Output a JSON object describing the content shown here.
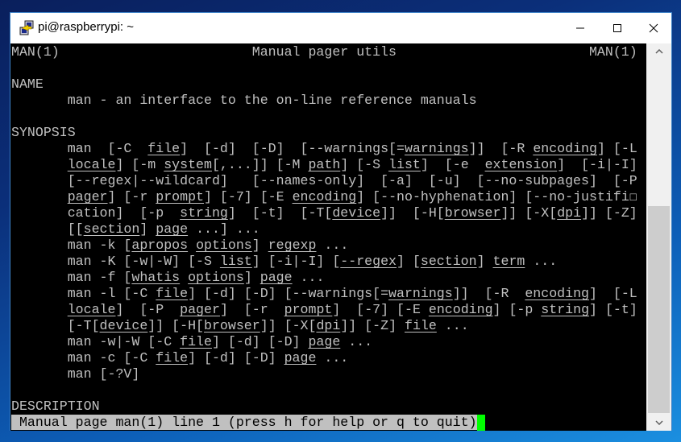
{
  "window": {
    "title": "pi@raspberrypi: ~",
    "icon": "putty-icon",
    "controls": {
      "minimize": "—",
      "maximize": "☐",
      "close": "✕"
    }
  },
  "terminal": {
    "lines": [
      [
        {
          "t": "MAN(1)                        Manual pager utils                        MAN(1)"
        }
      ],
      [
        {
          "t": ""
        }
      ],
      [
        {
          "t": "NAME"
        }
      ],
      [
        {
          "t": "       man - an interface to the on-line reference manuals"
        }
      ],
      [
        {
          "t": ""
        }
      ],
      [
        {
          "t": "SYNOPSIS"
        }
      ],
      [
        {
          "t": "       man  [-C  "
        },
        {
          "t": "file",
          "u": true
        },
        {
          "t": "]  [-d]  [-D]  [--warnings[="
        },
        {
          "t": "warnings",
          "u": true
        },
        {
          "t": "]]  [-R "
        },
        {
          "t": "encoding",
          "u": true
        },
        {
          "t": "] [-L"
        }
      ],
      [
        {
          "t": "       "
        },
        {
          "t": "locale",
          "u": true
        },
        {
          "t": "] [-m "
        },
        {
          "t": "system",
          "u": true
        },
        {
          "t": "[,...]] [-M "
        },
        {
          "t": "path",
          "u": true
        },
        {
          "t": "] [-S "
        },
        {
          "t": "list",
          "u": true
        },
        {
          "t": "]  [-e  "
        },
        {
          "t": "extension",
          "u": true
        },
        {
          "t": "]  [-i|-I]"
        }
      ],
      [
        {
          "t": "       [--regex|--wildcard]   [--names-only]  [-a]  [-u]  [--no-subpages]  [-P"
        }
      ],
      [
        {
          "t": "       "
        },
        {
          "t": "pager",
          "u": true
        },
        {
          "t": "] [-r "
        },
        {
          "t": "prompt",
          "u": true
        },
        {
          "t": "] [-7] [-E "
        },
        {
          "t": "encoding",
          "u": true
        },
        {
          "t": "] [--no-hyphenation] [--no-justifi☐"
        }
      ],
      [
        {
          "t": "       cation]  [-p  "
        },
        {
          "t": "string",
          "u": true
        },
        {
          "t": "]  [-t]  [-T["
        },
        {
          "t": "device",
          "u": true
        },
        {
          "t": "]]  [-H["
        },
        {
          "t": "browser",
          "u": true
        },
        {
          "t": "]] [-X["
        },
        {
          "t": "dpi",
          "u": true
        },
        {
          "t": "]] [-Z]"
        }
      ],
      [
        {
          "t": "       [["
        },
        {
          "t": "section",
          "u": true
        },
        {
          "t": "] "
        },
        {
          "t": "page",
          "u": true
        },
        {
          "t": " ...] ..."
        }
      ],
      [
        {
          "t": "       man -k ["
        },
        {
          "t": "apropos",
          "u": true
        },
        {
          "t": " "
        },
        {
          "t": "options",
          "u": true
        },
        {
          "t": "] "
        },
        {
          "t": "regexp",
          "u": true
        },
        {
          "t": " ..."
        }
      ],
      [
        {
          "t": "       man -K [-w|-W] [-S "
        },
        {
          "t": "list",
          "u": true
        },
        {
          "t": "] [-i|-I] ["
        },
        {
          "t": "--regex",
          "u": true
        },
        {
          "t": "] ["
        },
        {
          "t": "section",
          "u": true
        },
        {
          "t": "] "
        },
        {
          "t": "term",
          "u": true
        },
        {
          "t": " ..."
        }
      ],
      [
        {
          "t": "       man -f ["
        },
        {
          "t": "whatis",
          "u": true
        },
        {
          "t": " "
        },
        {
          "t": "options",
          "u": true
        },
        {
          "t": "] "
        },
        {
          "t": "page",
          "u": true
        },
        {
          "t": " ..."
        }
      ],
      [
        {
          "t": "       man -l [-C "
        },
        {
          "t": "file",
          "u": true
        },
        {
          "t": "] [-d] [-D] [--warnings[="
        },
        {
          "t": "warnings",
          "u": true
        },
        {
          "t": "]]  [-R  "
        },
        {
          "t": "encoding",
          "u": true
        },
        {
          "t": "]  [-L"
        }
      ],
      [
        {
          "t": "       "
        },
        {
          "t": "locale",
          "u": true
        },
        {
          "t": "]  [-P  "
        },
        {
          "t": "pager",
          "u": true
        },
        {
          "t": "]  [-r  "
        },
        {
          "t": "prompt",
          "u": true
        },
        {
          "t": "]  [-7] [-E "
        },
        {
          "t": "encoding",
          "u": true
        },
        {
          "t": "] [-p "
        },
        {
          "t": "string",
          "u": true
        },
        {
          "t": "] [-t]"
        }
      ],
      [
        {
          "t": "       [-T["
        },
        {
          "t": "device",
          "u": true
        },
        {
          "t": "]] [-H["
        },
        {
          "t": "browser",
          "u": true
        },
        {
          "t": "]] [-X["
        },
        {
          "t": "dpi",
          "u": true
        },
        {
          "t": "]] [-Z] "
        },
        {
          "t": "file",
          "u": true
        },
        {
          "t": " ..."
        }
      ],
      [
        {
          "t": "       man -w|-W [-C "
        },
        {
          "t": "file",
          "u": true
        },
        {
          "t": "] [-d] [-D] "
        },
        {
          "t": "page",
          "u": true
        },
        {
          "t": " ..."
        }
      ],
      [
        {
          "t": "       man -c [-C "
        },
        {
          "t": "file",
          "u": true
        },
        {
          "t": "] [-d] [-D] "
        },
        {
          "t": "page",
          "u": true
        },
        {
          "t": " ..."
        }
      ],
      [
        {
          "t": "       man [-?V]"
        }
      ],
      [
        {
          "t": ""
        }
      ],
      [
        {
          "t": "DESCRIPTION"
        }
      ]
    ],
    "status_line": " Manual page man(1) line 1 (press h for help or q to quit)",
    "colors": {
      "background": "#000000",
      "foreground": "#c0c0c0",
      "status_bg": "#c0c0c0",
      "cursor": "#00ff00"
    }
  },
  "scrollbar": {
    "up_icon": "⌃",
    "down_icon": "⌄"
  }
}
